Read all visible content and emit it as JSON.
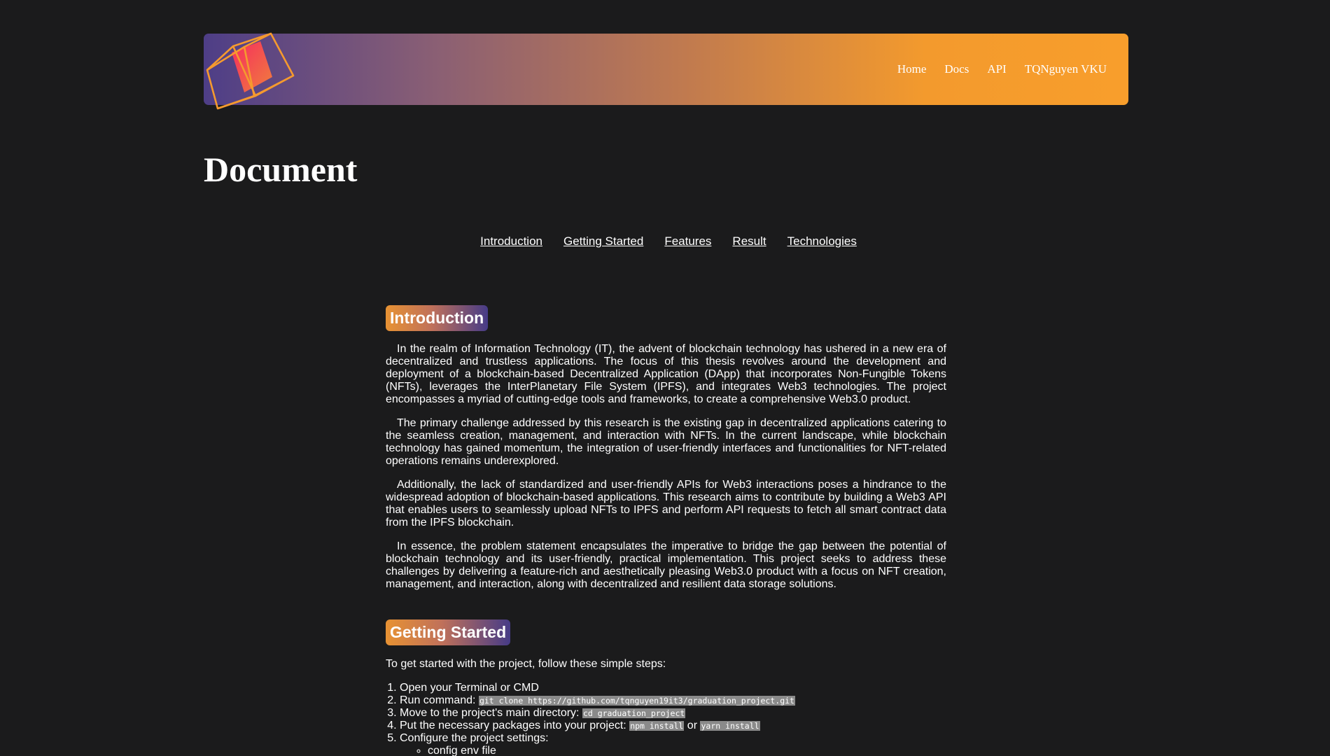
{
  "header": {
    "logo_icon": "cube-logo-icon",
    "nav": [
      {
        "label": "Home"
      },
      {
        "label": "Docs"
      },
      {
        "label": "API"
      },
      {
        "label": "TQNguyen VKU"
      }
    ],
    "gradient_colors": [
      "#4e3e87",
      "#f89e2c"
    ]
  },
  "page": {
    "title": "Document"
  },
  "section_nav": [
    {
      "label": "Introduction"
    },
    {
      "label": "Getting Started"
    },
    {
      "label": "Features"
    },
    {
      "label": "Result"
    },
    {
      "label": "Technologies"
    }
  ],
  "introduction": {
    "heading": "Introduction",
    "paragraphs": [
      "In the realm of Information Technology (IT), the advent of blockchain technology has ushered in a new era of decentralized and trustless applications. The focus of this thesis revolves around the development and deployment of a blockchain-based Decentralized Application (DApp) that incorporates Non-Fungible Tokens (NFTs), leverages the InterPlanetary File System (IPFS), and integrates Web3 technologies. The project encompasses a myriad of cutting-edge tools and frameworks, to create a comprehensive Web3.0 product.",
      "The primary challenge addressed by this research is the existing gap in decentralized applications catering to the seamless creation, management, and interaction with NFTs. In the current landscape, while blockchain technology has gained momentum, the integration of user-friendly interfaces and functionalities for NFT-related operations remains underexplored.",
      "Additionally, the lack of standardized and user-friendly APIs for Web3 interactions poses a hindrance to the widespread adoption of blockchain-based applications. This research aims to contribute by building a Web3 API that enables users to seamlessly upload NFTs to IPFS and perform API requests to fetch all smart contract data from the IPFS blockchain.",
      "In essence, the problem statement encapsulates the imperative to bridge the gap between the potential of blockchain technology and its user-friendly, practical implementation. This project seeks to address these challenges by delivering a feature-rich and aesthetically pleasing Web3.0 product with a focus on NFT creation, management, and interaction, along with decentralized and resilient data storage solutions."
    ]
  },
  "getting_started": {
    "heading": "Getting Started",
    "intro": "To get started with the project, follow these simple steps:",
    "step1": "Open your Terminal or CMD",
    "step2_text": "Run command: ",
    "step2_code": "git clone https://github.com/tqnguyen19it3/graduation_project.git",
    "step3_text": "Move to the project's main directory: ",
    "step3_code": "cd graduation_project",
    "step4_text": "Put the necessary packages into your project: ",
    "step4_code1": "npm install",
    "step4_or": " or ",
    "step4_code2": "yarn install",
    "step5_text": "Configure the project settings:",
    "step5_sub1": "config env file"
  }
}
